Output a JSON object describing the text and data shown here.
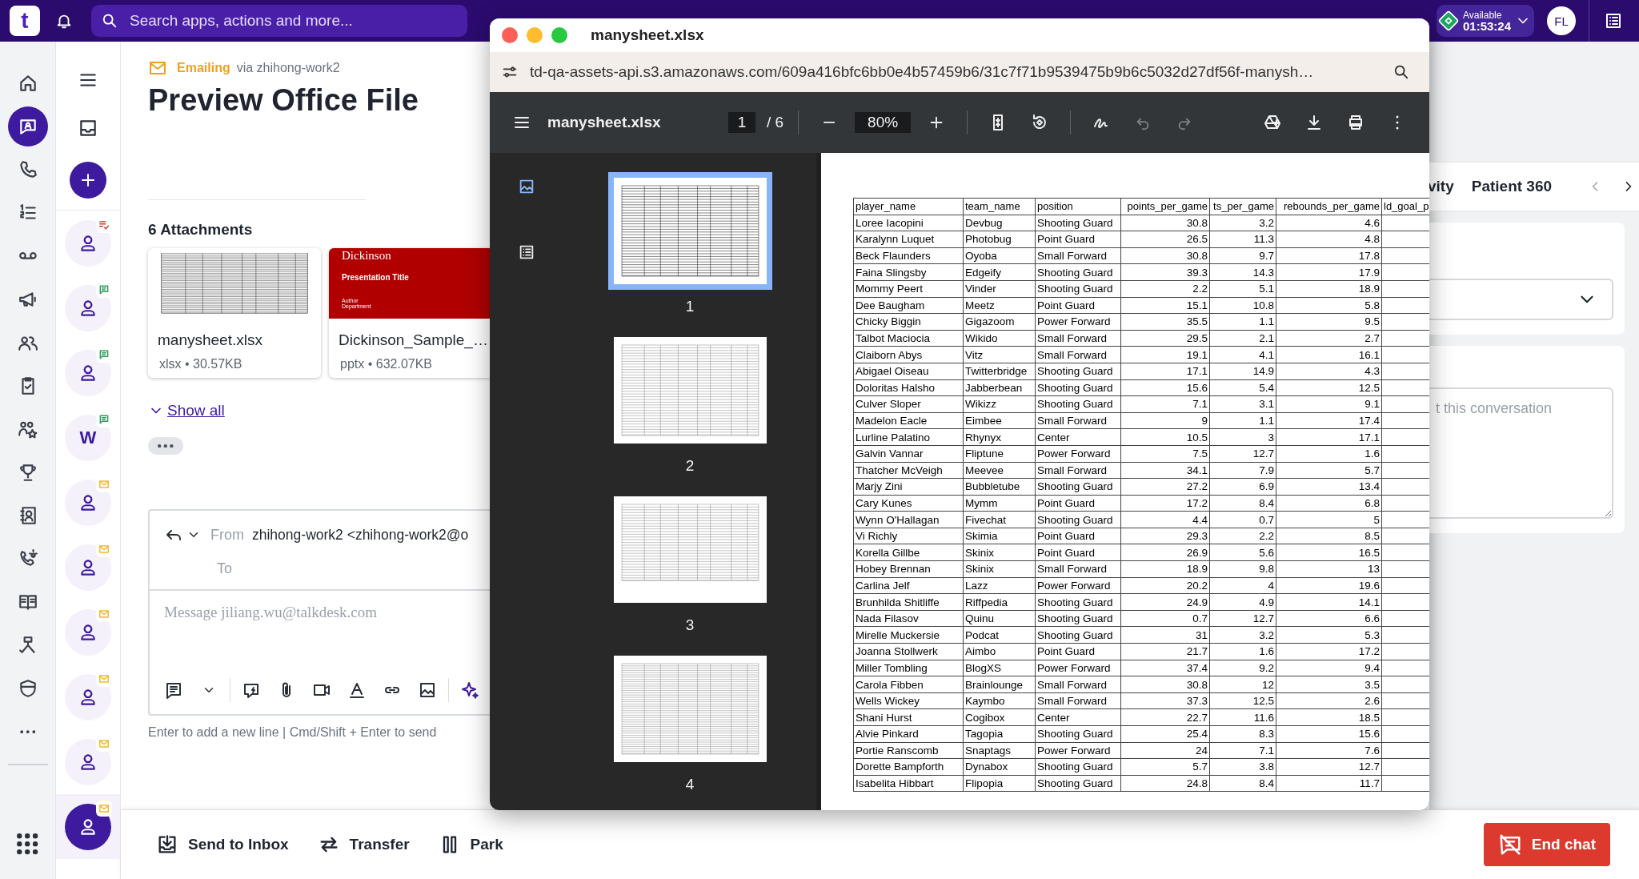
{
  "topbar": {
    "logo": "t",
    "search": {
      "placeholder": "Search apps, actions and more..."
    },
    "status": {
      "label": "Available",
      "timer": "01:53:24"
    },
    "avatar": "FL"
  },
  "rail": {
    "items": [
      {
        "kind": "home",
        "selected": false
      },
      {
        "kind": "chat",
        "selected": true
      },
      {
        "kind": "phone",
        "selected": false
      },
      {
        "kind": "list",
        "selected": false
      },
      {
        "kind": "voicemail",
        "selected": false
      },
      {
        "kind": "megaphone",
        "selected": false
      },
      {
        "kind": "people",
        "selected": false
      },
      {
        "kind": "clipboard",
        "selected": false
      },
      {
        "kind": "team",
        "selected": false
      },
      {
        "kind": "trophy",
        "selected": false
      },
      {
        "kind": "contact",
        "selected": false
      },
      {
        "kind": "phonegear",
        "selected": false
      },
      {
        "kind": "book",
        "selected": false
      },
      {
        "kind": "flow",
        "selected": false
      },
      {
        "kind": "shield",
        "selected": false
      },
      {
        "kind": "more",
        "selected": false
      }
    ]
  },
  "conversations": [
    {
      "kind": "person",
      "badge": {
        "kind": "task",
        "color": "#e53935"
      },
      "selected": false
    },
    {
      "kind": "person",
      "badge": {
        "kind": "chat",
        "color": "#2e9e5b"
      },
      "selected": false
    },
    {
      "kind": "person",
      "badge": {
        "kind": "chat",
        "color": "#2e9e5b"
      },
      "selected": false
    },
    {
      "kind": "letter",
      "text": "W",
      "badge": {
        "kind": "chat",
        "color": "#2e9e5b"
      },
      "selected": false
    },
    {
      "kind": "person",
      "badge": {
        "kind": "email",
        "color": "#f5b82e"
      },
      "selected": false
    },
    {
      "kind": "person",
      "badge": {
        "kind": "email",
        "color": "#f5b82e"
      },
      "selected": false
    },
    {
      "kind": "person",
      "badge": {
        "kind": "email",
        "color": "#f5b82e"
      },
      "selected": false
    },
    {
      "kind": "person",
      "badge": {
        "kind": "email",
        "color": "#f5b82e"
      },
      "selected": false
    },
    {
      "kind": "person",
      "badge": {
        "kind": "email",
        "color": "#f5b82e"
      },
      "selected": false
    },
    {
      "kind": "person",
      "badge": {
        "kind": "email",
        "color": "#f5b82e"
      },
      "selected": true
    }
  ],
  "main": {
    "channel": "Emailing",
    "via": "via zhihong-work2",
    "title": "Preview Office File",
    "attachments_title": "6 Attachments",
    "attachments": [
      {
        "kind": "sheet",
        "name": "manysheet.xlsx",
        "meta": "xlsx • 30.57KB"
      },
      {
        "kind": "slides",
        "name": "Dickinson_Sample_…",
        "meta": "pptx • 632.07KB",
        "slide_heading": "Dickinson",
        "slide_title": "Presentation Title",
        "slide_author": "Author",
        "slide_department": "Department"
      }
    ],
    "show_all": "Show all",
    "composer": {
      "from_label": "From",
      "from": "zhihong-work2 <zhihong-work2@o",
      "to_label": "To",
      "placeholder": "Message jiliang.wu@talkdesk.com",
      "hint": "Enter to add a new line | Cmd/Shift + Enter to send"
    }
  },
  "viewer": {
    "window_title": "manysheet.xlsx",
    "url": "td-qa-assets-api.s3.amazonaws.com/609a416bfc6bb0e4b57459b6/31c7f71b9539475b9b6c5032d27df56f-manysh…",
    "file_name": "manysheet.xlsx",
    "page": "1",
    "page_count": "/ 6",
    "zoom": "80%",
    "side_views": [
      {
        "kind": "thumbnails",
        "selected": true
      },
      {
        "kind": "outline",
        "selected": false
      }
    ],
    "thumbnails": [
      {
        "label": "1",
        "selected": true
      },
      {
        "label": "2",
        "selected": false
      },
      {
        "label": "3",
        "selected": false
      },
      {
        "label": "4",
        "selected": false
      }
    ],
    "table": {
      "columns": [
        {
          "label": "player_name",
          "kind": "text"
        },
        {
          "label": "team_name",
          "kind": "text"
        },
        {
          "label": "position",
          "kind": "text"
        },
        {
          "label": "points_per_game",
          "kind": "number"
        },
        {
          "label": "ts_per_game",
          "kind": "number"
        },
        {
          "label": "rebounds_per_game",
          "kind": "number"
        },
        {
          "label": "ld_goal_p",
          "kind": "text"
        }
      ],
      "rows": [
        [
          "Loree Iacopini",
          "Devbug",
          "Shooting Guard",
          "30.8",
          "3.2",
          "4.6"
        ],
        [
          "Karalynn Luquet",
          "Photobug",
          "Point Guard",
          "26.5",
          "11.3",
          "4.8"
        ],
        [
          "Beck Flaunders",
          "Oyoba",
          "Small Forward",
          "30.8",
          "9.7",
          "17.8"
        ],
        [
          "Faina Slingsby",
          "Edgeify",
          "Shooting Guard",
          "39.3",
          "14.3",
          "17.9"
        ],
        [
          "Mommy Peert",
          "Vinder",
          "Shooting Guard",
          "2.2",
          "5.1",
          "18.9"
        ],
        [
          "Dee Baugham",
          "Meetz",
          "Point Guard",
          "15.1",
          "10.8",
          "5.8"
        ],
        [
          "Chicky Biggin",
          "Gigazoom",
          "Power Forward",
          "35.5",
          "1.1",
          "9.5"
        ],
        [
          "Talbot Maciocia",
          "Wikido",
          "Small Forward",
          "29.5",
          "2.1",
          "2.7"
        ],
        [
          "Claiborn Abys",
          "Vitz",
          "Small Forward",
          "19.1",
          "4.1",
          "16.1"
        ],
        [
          "Abigael Oiseau",
          "Twitterbridge",
          "Shooting Guard",
          "17.1",
          "14.9",
          "4.3"
        ],
        [
          "Doloritas Halsho",
          "Jabberbean",
          "Shooting Guard",
          "15.6",
          "5.4",
          "12.5"
        ],
        [
          "Culver Sloper",
          "Wikizz",
          "Shooting Guard",
          "7.1",
          "3.1",
          "9.1"
        ],
        [
          "Madelon Eacle",
          "Eimbee",
          "Small Forward",
          "9",
          "1.1",
          "17.4"
        ],
        [
          "Lurline Palatino",
          "Rhynyx",
          "Center",
          "10.5",
          "3",
          "17.1"
        ],
        [
          "Galvin Vannar",
          "Fliptune",
          "Power Forward",
          "7.5",
          "12.7",
          "1.6"
        ],
        [
          "Thatcher McVeigh",
          "Meevee",
          "Small Forward",
          "34.1",
          "7.9",
          "5.7"
        ],
        [
          "Marjy Zini",
          "Bubbletube",
          "Shooting Guard",
          "27.2",
          "6.9",
          "13.4"
        ],
        [
          "Cary Kunes",
          "Mymm",
          "Point Guard",
          "17.2",
          "8.4",
          "6.8"
        ],
        [
          "Wynn O'Hallagan",
          "Fivechat",
          "Shooting Guard",
          "4.4",
          "0.7",
          "5"
        ],
        [
          "Vi Richly",
          "Skimia",
          "Point Guard",
          "29.3",
          "2.2",
          "8.5"
        ],
        [
          "Korella Gillbe",
          "Skinix",
          "Point Guard",
          "26.9",
          "5.6",
          "16.5"
        ],
        [
          "Hobey Brennan",
          "Skinix",
          "Small Forward",
          "18.9",
          "9.8",
          "13"
        ],
        [
          "Carlina Jelf",
          "Lazz",
          "Power Forward",
          "20.2",
          "4",
          "19.6"
        ],
        [
          "Brunhilda Shitliffe",
          "Riffpedia",
          "Shooting Guard",
          "24.9",
          "4.9",
          "14.1"
        ],
        [
          "Nada Filasov",
          "Quinu",
          "Shooting Guard",
          "0.7",
          "12.7",
          "6.6"
        ],
        [
          "Mirelle Muckersie",
          "Podcat",
          "Shooting Guard",
          "31",
          "3.2",
          "5.3"
        ],
        [
          "Joanna Stollwerk",
          "Aimbo",
          "Point Guard",
          "21.7",
          "1.6",
          "17.2"
        ],
        [
          "Miller Tombling",
          "BlogXS",
          "Power Forward",
          "37.4",
          "9.2",
          "9.4"
        ],
        [
          "Carola Fibben",
          "Brainlounge",
          "Small Forward",
          "30.8",
          "12",
          "3.5"
        ],
        [
          "Wells Wickey",
          "Kaymbo",
          "Small Forward",
          "37.3",
          "12.5",
          "2.6"
        ],
        [
          "Shani Hurst",
          "Cogibox",
          "Center",
          "22.7",
          "11.6",
          "18.5"
        ],
        [
          "Alvie Pinkard",
          "Tagopia",
          "Shooting Guard",
          "25.4",
          "8.3",
          "15.6"
        ],
        [
          "Portie Ranscomb",
          "Snaptags",
          "Power Forward",
          "24",
          "7.1",
          "7.6"
        ],
        [
          "Dorette Bampforth",
          "Dynabox",
          "Shooting Guard",
          "5.7",
          "3.8",
          "12.7"
        ],
        [
          "Isabelita Hibbart",
          "Flipopia",
          "Shooting Guard",
          "24.8",
          "8.4",
          "11.7"
        ]
      ]
    }
  },
  "right_panel": {
    "tabs": [
      "vity",
      "Patient 360"
    ],
    "notes_placeholder": "t this conversation"
  },
  "bottom_bar": {
    "actions": [
      {
        "kind": "inbox",
        "label": "Send to Inbox"
      },
      {
        "kind": "transfer",
        "label": "Transfer"
      },
      {
        "kind": "park",
        "label": "Park"
      }
    ],
    "end": "End chat"
  }
}
